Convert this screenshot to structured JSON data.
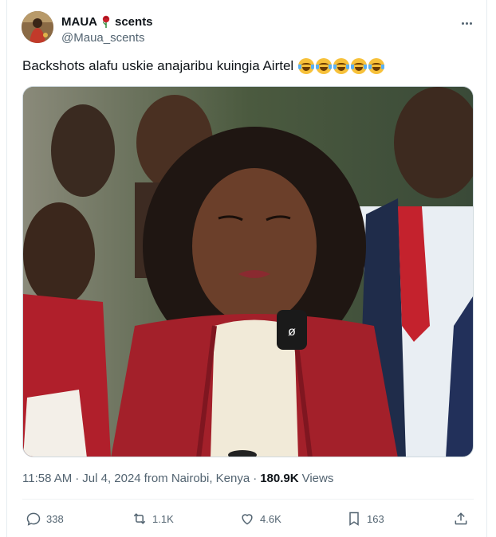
{
  "author": {
    "display_name": "MAUA",
    "display_name_suffix": "scents",
    "handle": "@Maua_scents"
  },
  "tweet": {
    "text": "Backshots alafu uskie anajaribu kuingia Airtel",
    "emoji_count": 5,
    "emoji_name": "crying-laughing-cat"
  },
  "media": {
    "mic_label": "ø"
  },
  "meta": {
    "time": "11:58 AM",
    "sep1": "·",
    "date": "Jul 4, 2024",
    "location": "from Nairobi, Kenya",
    "sep2": "·",
    "views_count": "180.9K",
    "views_label": "Views"
  },
  "actions": {
    "replies": "338",
    "reposts": "1.1K",
    "likes": "4.6K",
    "bookmarks": "163"
  },
  "icons": {
    "reply": "reply-icon",
    "repost": "repost-icon",
    "like": "like-icon",
    "bookmark": "bookmark-icon",
    "share": "share-icon",
    "more": "more-icon",
    "rose": "rose-icon"
  },
  "colors": {
    "text": "#0f1419",
    "secondary": "#536471",
    "robe": "#a3202a"
  }
}
